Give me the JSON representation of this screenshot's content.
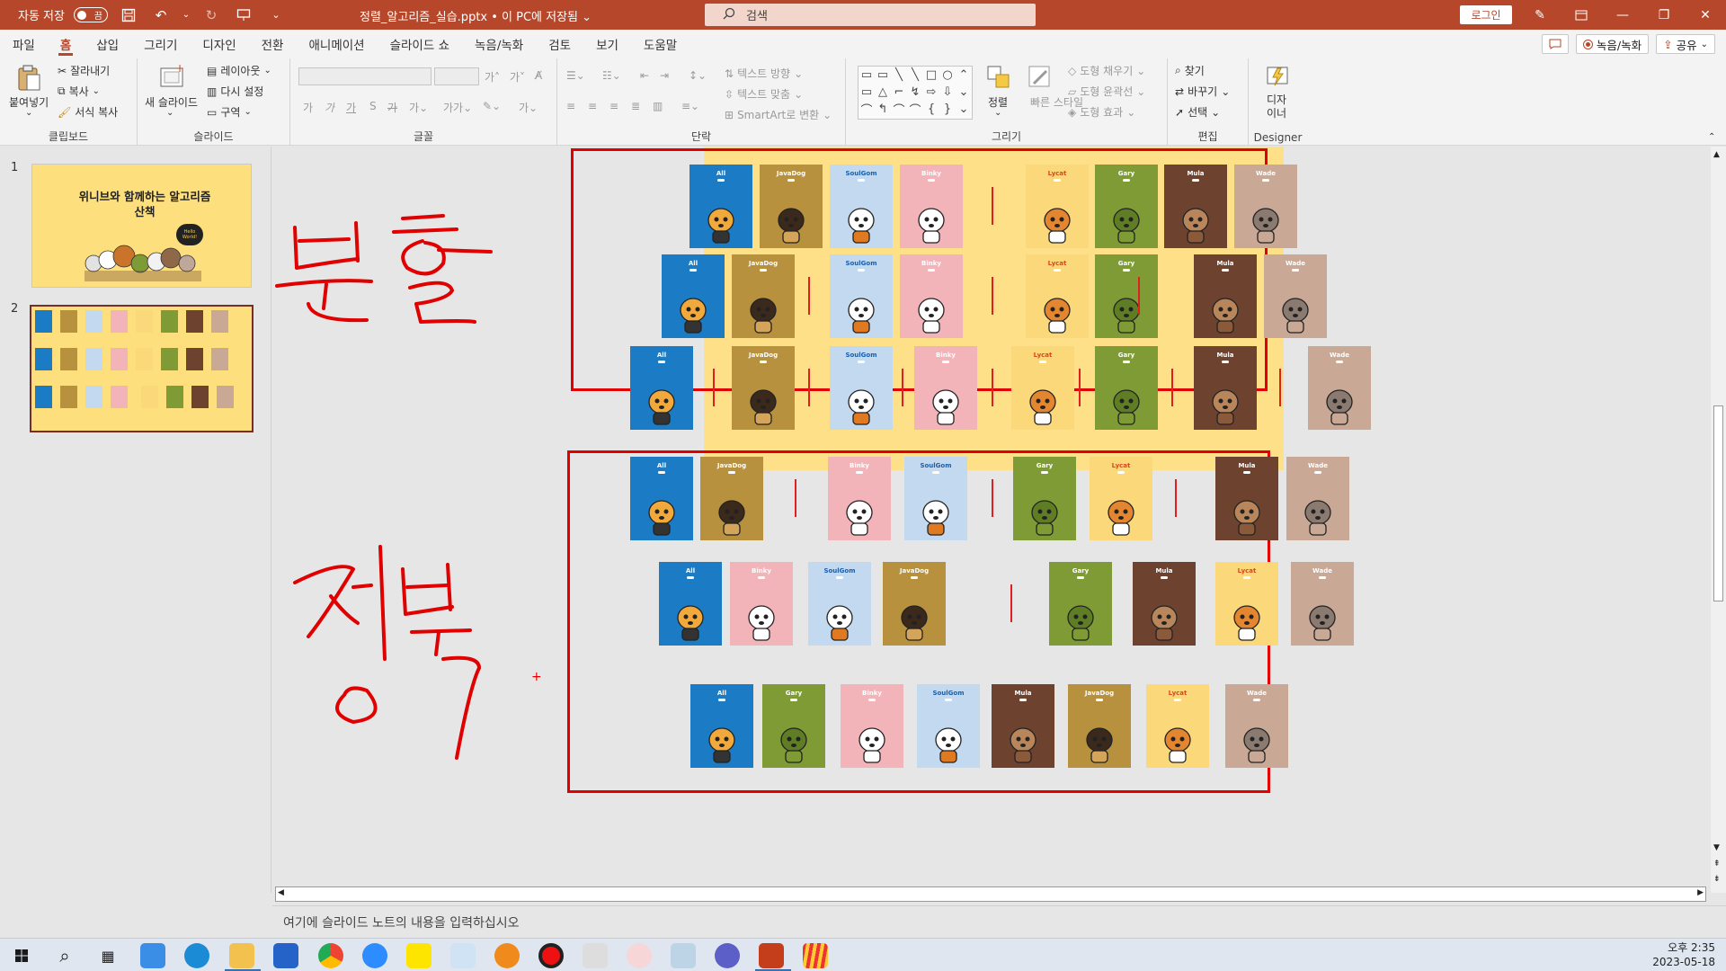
{
  "titlebar": {
    "autosave_label": "자동 저장",
    "autosave_state": "끔",
    "doc_title": "정렬_알고리즘_실습.pptx • 이 PC에 저장됨 ⌄",
    "search_placeholder": "검색",
    "login_label": "로그인",
    "accent": "#b7472a"
  },
  "menu": {
    "tabs": [
      "파일",
      "홈",
      "삽입",
      "그리기",
      "디자인",
      "전환",
      "애니메이션",
      "슬라이드 쇼",
      "녹음/녹화",
      "검토",
      "보기",
      "도움말"
    ],
    "record_label": "녹음/녹화",
    "share_label": "공유"
  },
  "ribbon": {
    "clipboard": {
      "paste": "붙여넣기",
      "cut": "잘라내기",
      "copy": "복사",
      "format_painter": "서식 복사",
      "label": "클립보드"
    },
    "slides": {
      "new_slide": "새 슬라이드",
      "layout": "레이아웃",
      "reset": "다시 설정",
      "section": "구역",
      "label": "슬라이드"
    },
    "font": {
      "label": "글꼴"
    },
    "paragraph": {
      "text_direction": "텍스트 방향",
      "align_text": "텍스트 맞춤",
      "smartart": "SmartArt로 변환",
      "label": "단락"
    },
    "drawing": {
      "arrange": "정렬",
      "quick_styles": "빠른 스타일",
      "shape_fill": "도형 채우기",
      "shape_outline": "도형 윤곽선",
      "shape_effects": "도형 효과",
      "label": "그리기"
    },
    "editing": {
      "find": "찾기",
      "replace": "바꾸기",
      "select": "선택",
      "label": "편집"
    },
    "designer": {
      "button": "디자\n이너",
      "label": "Designer"
    }
  },
  "thumbnails": [
    {
      "number": "1",
      "title": "위니브와 함께하는 알고리즘 산책",
      "badge": "Hello World!"
    },
    {
      "number": "2"
    }
  ],
  "annotations": {
    "top_word": "분할",
    "bottom_word": "정복"
  },
  "characters": {
    "All": {
      "color": "#1b7bc4"
    },
    "JavaDog": {
      "color": "#b8913f"
    },
    "SoulGom": {
      "color": "#c3d9f0",
      "text_color": "#1b5fa8"
    },
    "Binky": {
      "color": "#f2b4b8"
    },
    "Lycat": {
      "color": "#fbd97a",
      "text_color": "#d9481c"
    },
    "Gary": {
      "color": "#7e9b35"
    },
    "Mula": {
      "color": "#6d4330"
    },
    "Wade": {
      "color": "#c9a896"
    }
  },
  "rows": {
    "divide_1": [
      "All",
      "JavaDog",
      "SoulGom",
      "Binky",
      "Lycat",
      "Gary",
      "Mula",
      "Wade"
    ],
    "divide_2": [
      "All",
      "JavaDog",
      "SoulGom",
      "Binky",
      "Lycat",
      "Gary",
      "Mula",
      "Wade"
    ],
    "divide_3": [
      "All",
      "JavaDog",
      "SoulGom",
      "Binky",
      "Lycat",
      "Gary",
      "Mula",
      "Wade"
    ],
    "conquer_1": [
      "All",
      "JavaDog",
      "Binky",
      "SoulGom",
      "Gary",
      "Lycat",
      "Mula",
      "Wade"
    ],
    "conquer_2": [
      "All",
      "Binky",
      "SoulGom",
      "JavaDog",
      "Gary",
      "Mula",
      "Lycat",
      "Wade"
    ],
    "conquer_3": [
      "All",
      "Gary",
      "Binky",
      "SoulGom",
      "Mula",
      "JavaDog",
      "Lycat",
      "Wade"
    ]
  },
  "notes_placeholder": "여기에 슬라이드 노트의 내용을 입력하십시오",
  "clock": {
    "time": "오후 2:35",
    "date": "2023-05-18"
  }
}
